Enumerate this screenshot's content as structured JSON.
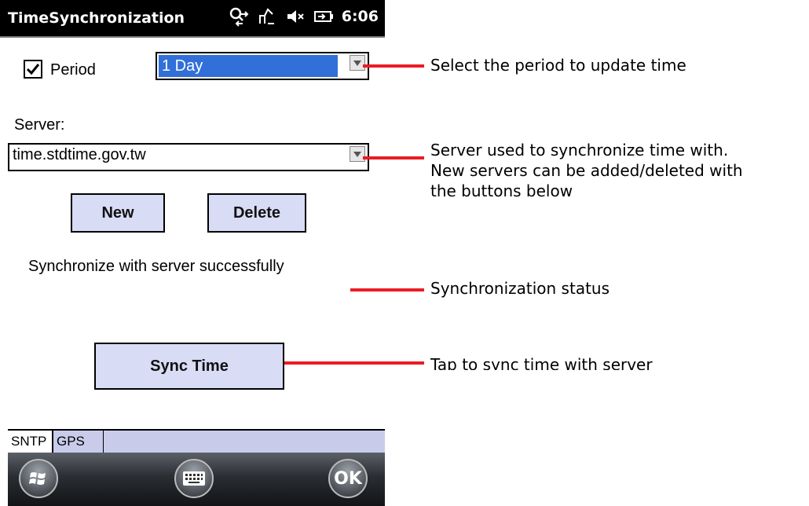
{
  "window": {
    "title": "TimeSynchronization",
    "clock": "6:06"
  },
  "icons": {
    "connect": "connection-icon",
    "signal": "signal-icon",
    "volume": "volume-muted-icon",
    "battery": "battery-icon"
  },
  "period": {
    "checked": true,
    "label": "Period",
    "selected": "1 Day"
  },
  "server": {
    "label": "Server:",
    "selected": "time.stdtime.gov.tw"
  },
  "buttons": {
    "new": "New",
    "delete": "Delete",
    "sync": "Sync Time"
  },
  "status_text": "Synchronize with server successfully",
  "tabs": [
    {
      "label": "SNTP",
      "active": true
    },
    {
      "label": "GPS",
      "active": false
    }
  ],
  "bottom": {
    "ok": "OK"
  },
  "callouts": {
    "period": "Select the period to update time",
    "server_line1": "Server used to synchronize time with.",
    "server_line2": "New servers can be added/deleted with",
    "server_line3": "the buttons below",
    "status": "Synchronization status",
    "sync": "Tap to sync time with server"
  },
  "colors": {
    "accent": "#ea1c24",
    "selection": "#3170d8",
    "button": "#d8dcf5"
  }
}
